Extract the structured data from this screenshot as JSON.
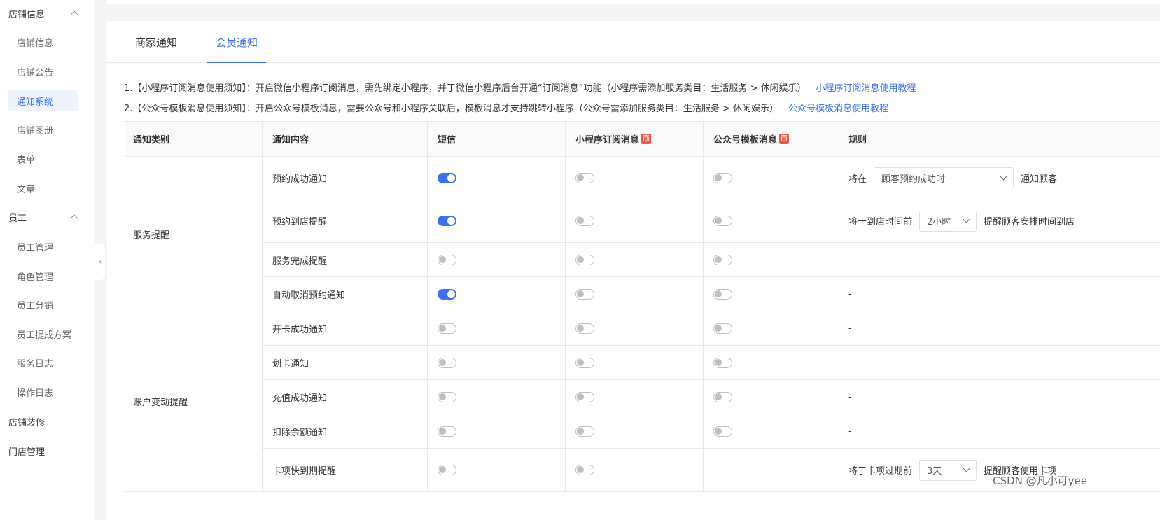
{
  "sidebar": {
    "group_store": "店铺信息",
    "store_items": [
      "店铺信息",
      "店铺公告",
      "通知系统",
      "店铺图册",
      "表单",
      "文章"
    ],
    "group_staff": "员工",
    "staff_items": [
      "员工管理",
      "角色管理",
      "员工分销",
      "员工提成方案",
      "服务日志",
      "操作日志"
    ],
    "store_decoration": "店铺装修",
    "store_management": "门店管理",
    "collapse_glyph": "‹"
  },
  "tabs": {
    "merchant": "商家通知",
    "member": "会员通知"
  },
  "notes": {
    "line1": "1.【小程序订阅消息使用须知】：开启微信小程序订阅消息，需先绑定小程序，并于微信小程序后台开通“订阅消息”功能（小程序需添加服务类目：生活服务 > 休闲娱乐）",
    "line1_link": "小程序订阅消息使用教程",
    "line2": "2.【公众号模板消息使用须知】：开启公众号模板消息，需要公众号和小程序关联后，模板消息才支持跳转小程序（公众号需添加服务类目：生活服务 > 休闲娱乐）",
    "line2_link": "公众号模板消息使用教程"
  },
  "table": {
    "headers": {
      "category": "通知类别",
      "content": "通知内容",
      "sms": "短信",
      "mini": "小程序订阅消息",
      "official": "公众号模板消息",
      "rule": "规则",
      "badge": "商"
    },
    "groups": [
      {
        "name": "服务提醒",
        "rows": [
          {
            "label": "预约成功通知",
            "sms": true,
            "mini": false,
            "official": false,
            "rule": {
              "prefix": "将在",
              "select": "顾客预约成功时",
              "suffix": "通知顾客"
            }
          },
          {
            "label": "预约到店提醒",
            "sms": true,
            "mini": false,
            "official": false,
            "rule": {
              "prefix": "将于到店时间前",
              "select": "2小时",
              "suffix": "提醒顾客安排时间到店"
            }
          },
          {
            "label": "服务完成提醒",
            "sms": false,
            "mini": false,
            "official": false,
            "rule": "-"
          },
          {
            "label": "自动取消预约通知",
            "sms": true,
            "mini": false,
            "official": false,
            "rule": "-"
          }
        ]
      },
      {
        "name": "账户变动提醒",
        "rows": [
          {
            "label": "开卡成功通知",
            "sms": false,
            "mini": false,
            "official": false,
            "rule": "-"
          },
          {
            "label": "划卡通知",
            "sms": false,
            "mini": false,
            "official": false,
            "rule": "-"
          },
          {
            "label": "充值成功通知",
            "sms": false,
            "mini": false,
            "official": false,
            "rule": "-"
          },
          {
            "label": "扣除余额通知",
            "sms": false,
            "mini": false,
            "official": false,
            "rule": "-"
          },
          {
            "label": "卡项快到期提醒",
            "sms": false,
            "mini": false,
            "official": "-",
            "rule": {
              "prefix": "将于卡项过期前",
              "select": "3天",
              "suffix": "提醒顾客使用卡项"
            }
          }
        ]
      }
    ]
  },
  "colors": {
    "accent": "#3a6ff7",
    "badge": "#f2543d"
  },
  "watermark": "CSDN @凡小可yee"
}
